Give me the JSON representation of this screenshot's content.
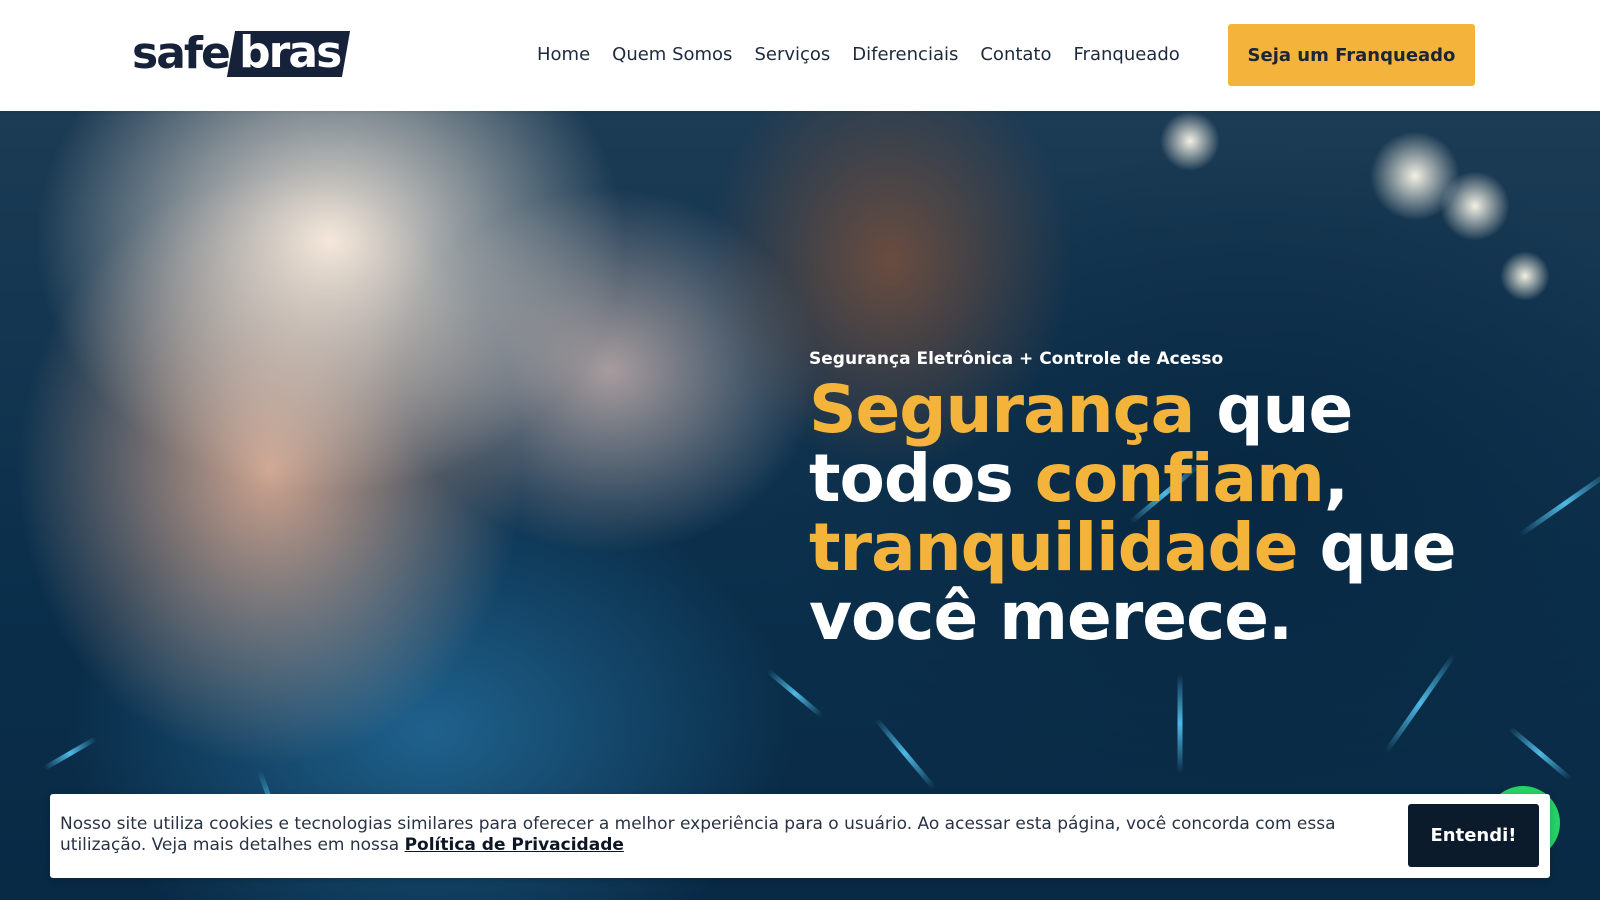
{
  "brand": {
    "logo_part1": "safe",
    "logo_part2": "bras",
    "primary_color": "#16213a",
    "accent_color": "#f4b43b"
  },
  "nav": {
    "items": [
      {
        "label": "Home"
      },
      {
        "label": "Quem Somos"
      },
      {
        "label": "Serviços"
      },
      {
        "label": "Diferenciais"
      },
      {
        "label": "Contato"
      },
      {
        "label": "Franqueado"
      }
    ],
    "cta_label": "Seja um Franqueado"
  },
  "hero": {
    "subtitle": "Segurança Eletrônica + Controle de Acesso",
    "headline": {
      "w1": "Segurança",
      "w2": " que",
      "w3": "todos ",
      "w4": "confiam",
      "w5": ",",
      "w6": "tranquilidade",
      "w7": " que",
      "w8": "você merece."
    }
  },
  "cookie_banner": {
    "text": "Nosso site utiliza cookies e tecnologias similares para oferecer a melhor experiência para o usuário. Ao acessar esta página, você concorda com essa utilização. Veja mais detalhes em nossa ",
    "link_label": "Política de Privacidade",
    "button_label": "Entendi!"
  },
  "whatsapp": {
    "icon": "whatsapp-icon",
    "color": "#25d366"
  }
}
